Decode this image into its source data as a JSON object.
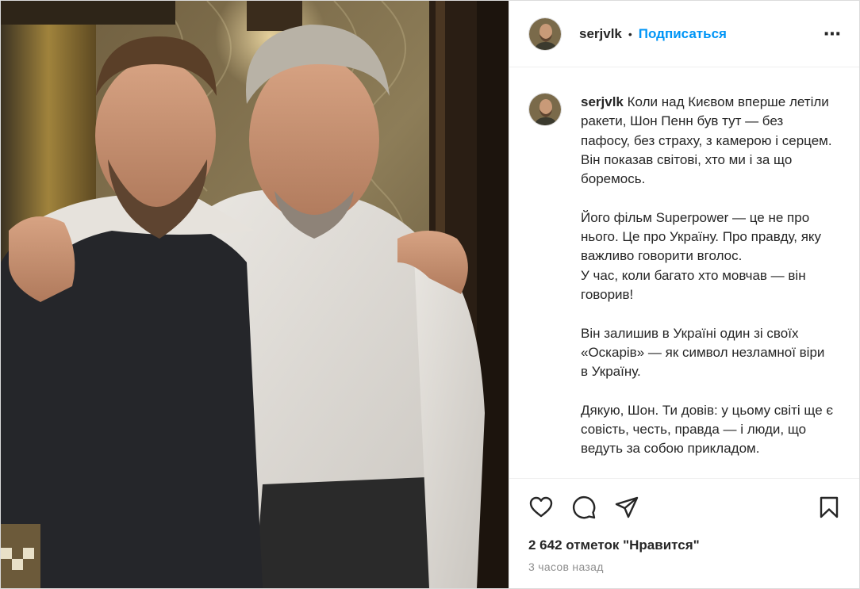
{
  "post": {
    "username": "serjvlk",
    "separator": "•",
    "follow_label": "Подписаться",
    "more_icon": "⋯",
    "caption_lines": [
      "Коли над Києвом вперше летіли ракети, Шон Пенн був тут — без пафосу, без страху, з камерою і серцем.",
      "Він показав світові, хто ми і за що боремось.",
      "",
      "Його фільм Superpower — це не про нього. Це про Україну. Про правду, яку важливо говорити вголос.",
      "У час, коли багато хто мовчав — він говорив!",
      "",
      "Він залишив в Україні один зі своїх «Оскарів» — як символ незламної віри в Україну.",
      "",
      "Дякую, Шон. Ти довів: у цьому світі ще є совість, честь, правда — і люди, що ведуть за собою прикладом."
    ],
    "likes_text": "2 642 отметок \"Нравится\"",
    "time_text": "3 часов назад"
  },
  "icons": {
    "like": "heart-icon",
    "comment": "comment-icon",
    "share": "share-icon",
    "save": "bookmark-icon",
    "more": "more-icon"
  },
  "colors": {
    "accent": "#0095f6",
    "text": "#262626",
    "muted": "#8e8e8e",
    "border": "#dbdbdb"
  }
}
